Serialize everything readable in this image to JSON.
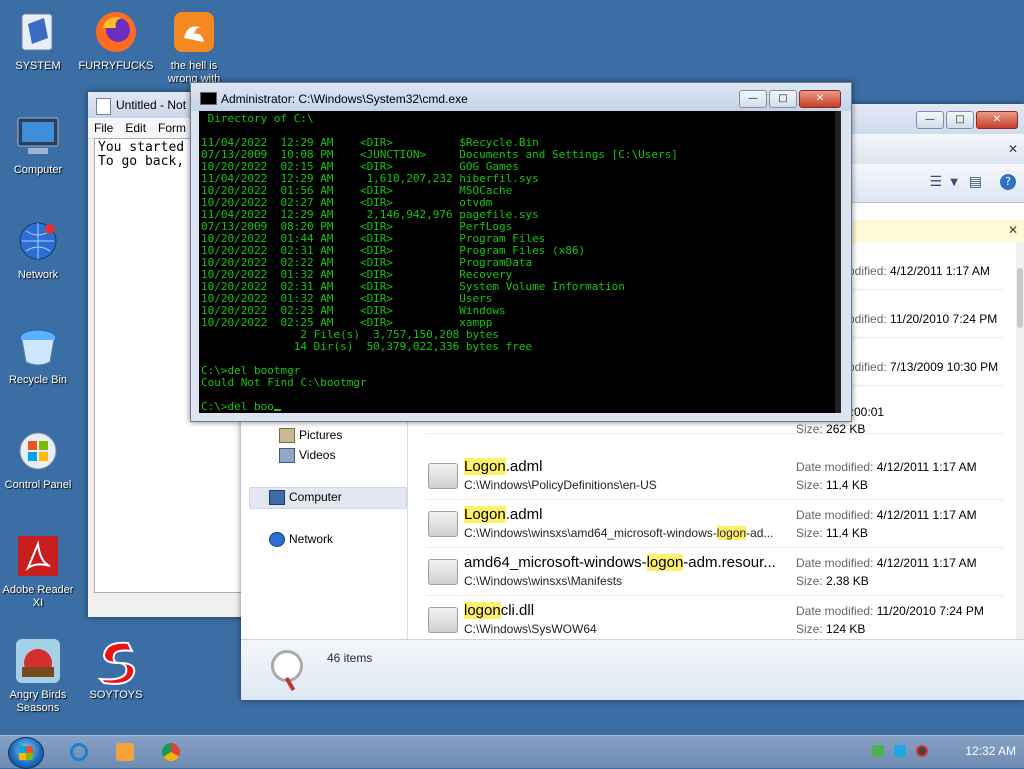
{
  "desktop": {
    "icons": [
      {
        "label": "SYSTEM"
      },
      {
        "label": "FURRYFUCKS"
      },
      {
        "label": "the hell is wrong with"
      },
      {
        "label": "Computer"
      },
      {
        "label": "Network"
      },
      {
        "label": "Recycle Bin"
      },
      {
        "label": "Control Panel"
      },
      {
        "label": "Adobe Reader XI"
      },
      {
        "label": "Angry Birds Seasons"
      },
      {
        "label": "SOYTOYS"
      }
    ]
  },
  "notepad": {
    "title": "Untitled - Not",
    "menu": [
      "File",
      "Edit",
      "Form"
    ],
    "text": "You started\nTo go back,"
  },
  "cmd": {
    "title": "Administrator: C:\\Windows\\System32\\cmd.exe",
    "lines": [
      " Directory of C:\\",
      "",
      "11/04/2022  12:29 AM    <DIR>          $Recycle.Bin",
      "07/13/2009  10:08 PM    <JUNCTION>     Documents and Settings [C:\\Users]",
      "10/20/2022  02:15 AM    <DIR>          GOG Games",
      "11/04/2022  12:29 AM     1,610,207,232 hiberfil.sys",
      "10/20/2022  01:56 AM    <DIR>          MSOCache",
      "10/20/2022  02:27 AM    <DIR>          otvdm",
      "11/04/2022  12:29 AM     2,146,942,976 pagefile.sys",
      "07/13/2009  08:20 PM    <DIR>          PerfLogs",
      "10/20/2022  01:44 AM    <DIR>          Program Files",
      "10/20/2022  02:31 AM    <DIR>          Program Files (x86)",
      "10/20/2022  02:22 AM    <DIR>          ProgramData",
      "10/20/2022  01:32 AM    <DIR>          Recovery",
      "10/20/2022  02:31 AM    <DIR>          System Volume Information",
      "10/20/2022  01:32 AM    <DIR>          Users",
      "10/20/2022  02:23 AM    <DIR>          Windows",
      "10/20/2022  02:25 AM    <DIR>          xampp",
      "               2 File(s)  3,757,150,208 bytes",
      "              14 Dir(s)  50,379,022,336 bytes free",
      "",
      "C:\\>del bootmgr",
      "Could Not Find C:\\bootmgr",
      "",
      "C:\\>del boo"
    ]
  },
  "explorer": {
    "nav": {
      "pictures": "Pictures",
      "videos": "Videos",
      "computer": "Computer",
      "network": "Network"
    },
    "items": [
      {
        "name_pre": "",
        "name_hl": "",
        "name_post": "",
        "path": "",
        "meta1_label": "",
        "meta1_value": "0:00:01",
        "meta2_label": "Size:",
        "meta2_value": "262 KB"
      },
      {
        "name_pre": "",
        "name_hl": "Logon",
        "name_post": ".adml",
        "path": "C:\\Windows\\PolicyDefinitions\\en-US",
        "meta1_label": "Date modified:",
        "meta1_value": "4/12/2011 1:17 AM",
        "meta2_label": "Size:",
        "meta2_value": "11.4 KB"
      },
      {
        "name_pre": "",
        "name_hl": "Logon",
        "name_post": ".adml",
        "path_pre": "C:\\Windows\\winsxs\\amd64_microsoft-windows-",
        "path_hl": "logon",
        "path_post": "-ad...",
        "meta1_label": "Date modified:",
        "meta1_value": "4/12/2011 1:17 AM",
        "meta2_label": "Size:",
        "meta2_value": "11.4 KB"
      },
      {
        "name_pre": "amd64_microsoft-windows-",
        "name_hl": "logon",
        "name_post": "-adm.resour...",
        "path": "C:\\Windows\\winsxs\\Manifests",
        "meta1_label": "Date modified:",
        "meta1_value": "4/12/2011 1:17 AM",
        "meta2_label": "Size:",
        "meta2_value": "2.38 KB"
      },
      {
        "name_pre": "",
        "name_hl": "logon",
        "name_post": "cli.dll",
        "path": "C:\\Windows\\SysWOW64",
        "meta1_label": "Date modified:",
        "meta1_value": "11/20/2010 7:24 PM",
        "meta2_label": "Size:",
        "meta2_value": "124 KB"
      }
    ],
    "hidden_rows": [
      {
        "meta1_label": "odified:",
        "meta1_value": "4/12/2011 1:17 AM"
      },
      {
        "meta1_label": "odified:",
        "meta1_value": "11/20/2010 7:24 PM"
      },
      {
        "meta1_label": "odified:",
        "meta1_value": "7/13/2009 10:30 PM"
      }
    ],
    "item_count": "46 items"
  },
  "taskbar": {
    "clock": "12:32 AM"
  }
}
